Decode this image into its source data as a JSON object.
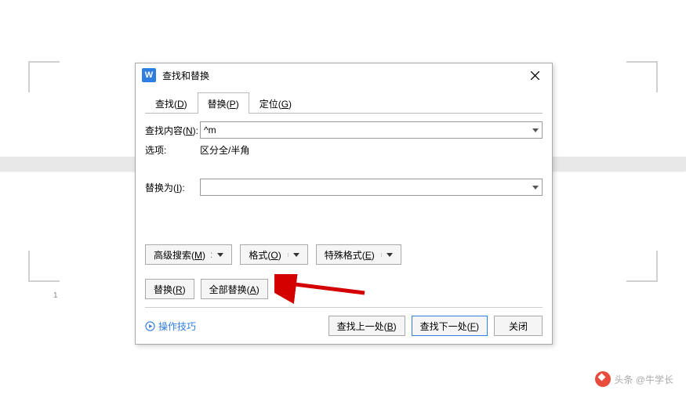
{
  "page_number": "1",
  "dialog": {
    "title": "查找和替换",
    "tabs": {
      "find": "查找(D)",
      "replace": "替换(P)",
      "goto": "定位(G)",
      "active": "replace"
    },
    "find_label": "查找内容(N):",
    "find_value": "^m",
    "options_label": "选项:",
    "options_value": "区分全/半角",
    "replace_label": "替换为(I):",
    "replace_value": "",
    "buttons": {
      "advanced": "高级搜索(M)",
      "format": "格式(O)",
      "special": "特殊格式(E)",
      "replace_one": "替换(R)",
      "replace_all": "全部替换(A)",
      "find_prev": "查找上一处(B)",
      "find_next": "查找下一处(F)",
      "close": "关闭"
    },
    "tips_label": "操作技巧"
  },
  "watermark": "头条 @牛学长"
}
